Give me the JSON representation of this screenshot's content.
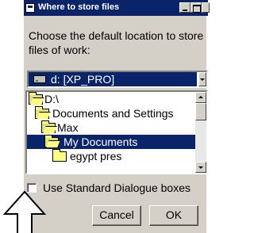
{
  "window": {
    "title": "Where to store files"
  },
  "prompt": "Choose the default location to store files of work:",
  "drive": {
    "selected": "d: [XP_PRO]"
  },
  "folders": [
    {
      "label": "D:\\",
      "state": "open"
    },
    {
      "label": "Documents and Settings",
      "state": "open"
    },
    {
      "label": "Max",
      "state": "open"
    },
    {
      "label": "My Documents",
      "state": "open",
      "selected": true
    },
    {
      "label": "egypt pres",
      "state": "closed"
    }
  ],
  "checkbox": {
    "label": "Use Standard Dialogue boxes",
    "checked": false
  },
  "buttons": {
    "cancel": "Cancel",
    "ok": "OK"
  },
  "colors": {
    "titlebar": "#0a246a",
    "selection": "#0a246a",
    "face": "#d4d0c8"
  }
}
